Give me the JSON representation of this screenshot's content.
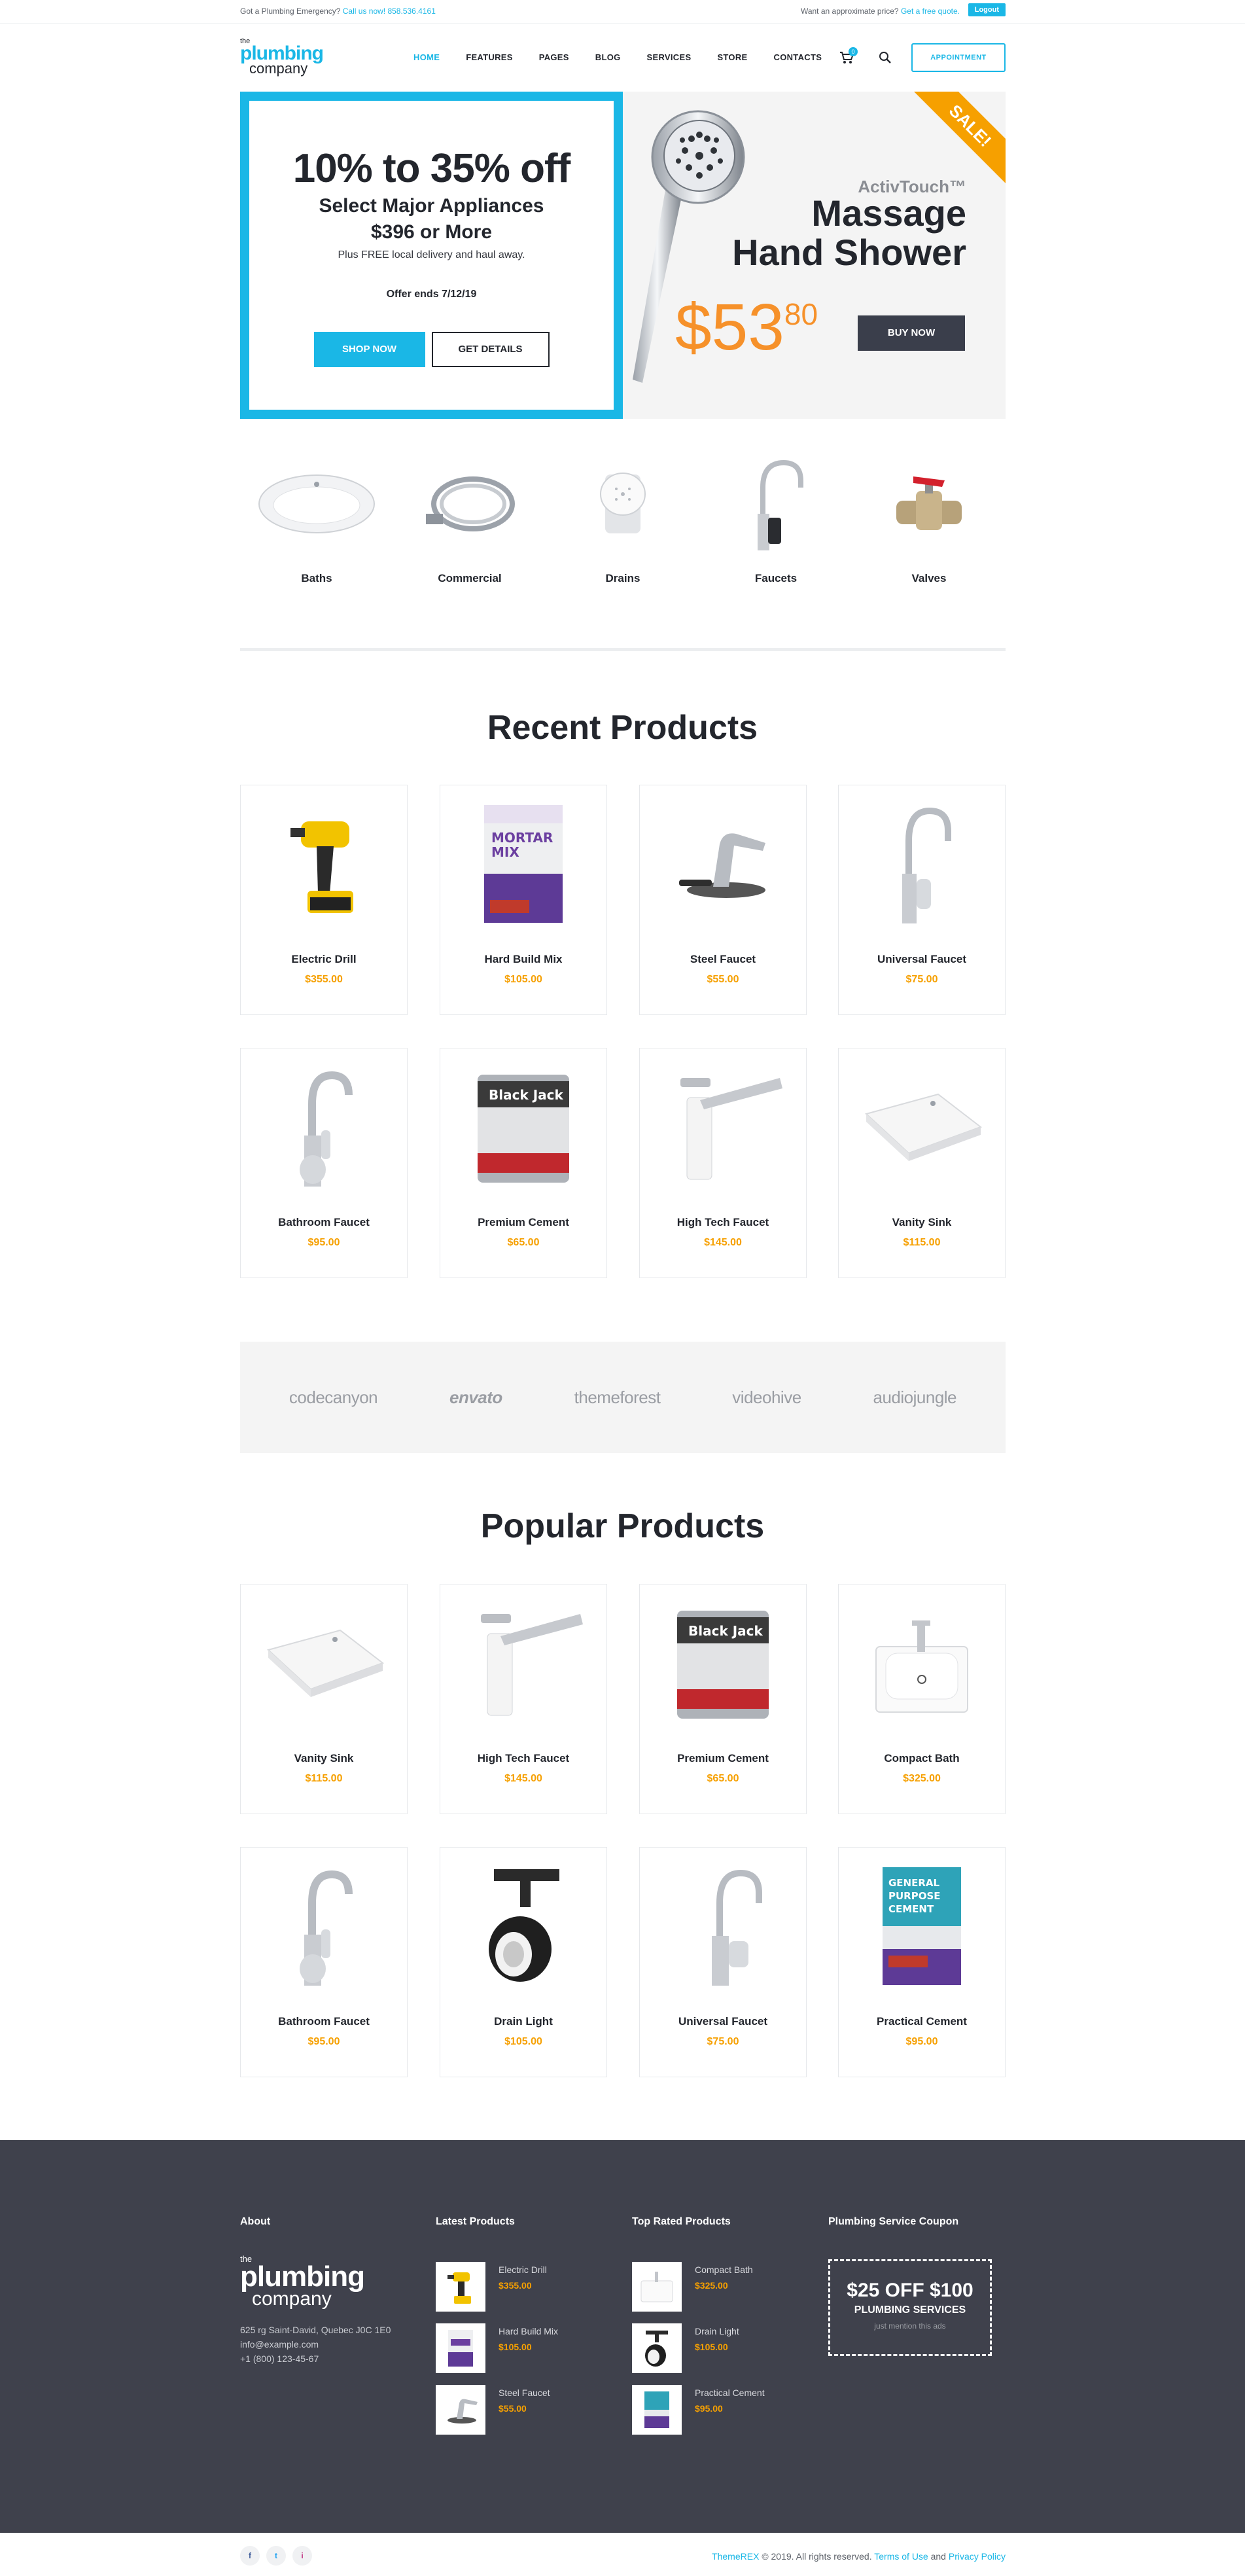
{
  "topbar": {
    "emergency_text": "Got a Plumbing Emergency?",
    "call_text": "Call us now! 858.536.4161",
    "quote_text": "Want an approximate price?",
    "quote_link": "Get a free quote.",
    "logout": "Logout"
  },
  "header": {
    "logo_the": "the",
    "logo_plumbing": "plumbing",
    "logo_company": "company",
    "nav": [
      "HOME",
      "FEATURES",
      "PAGES",
      "BLOG",
      "SERVICES",
      "STORE",
      "CONTACTS"
    ],
    "cart_count": "0",
    "appointment": "APPOINTMENT"
  },
  "hero": {
    "headline": "10% to 35% off",
    "sub1": "Select Major Appliances",
    "sub2": "$396 or More",
    "delivery": "Plus FREE local delivery and haul away.",
    "offer_ends": "Offer ends 7/12/19",
    "shop_now": "SHOP NOW",
    "get_details": "GET DETAILS",
    "sale": "SALE!",
    "brand": "ActivTouch™",
    "product_line1": "Massage",
    "product_line2": "Hand Shower",
    "price_main": "$53",
    "price_cents": "80",
    "buy_now": "BUY NOW"
  },
  "categories": [
    "Baths",
    "Commercial",
    "Drains",
    "Faucets",
    "Valves"
  ],
  "recent": {
    "title": "Recent Products",
    "items": [
      {
        "name": "Electric Drill",
        "price": "$355.00"
      },
      {
        "name": "Hard Build Mix",
        "price": "$105.00"
      },
      {
        "name": "Steel Faucet",
        "price": "$55.00"
      },
      {
        "name": "Universal Faucet",
        "price": "$75.00"
      },
      {
        "name": "Bathroom Faucet",
        "price": "$95.00"
      },
      {
        "name": "Premium Cement",
        "price": "$65.00"
      },
      {
        "name": "High Tech Faucet",
        "price": "$145.00"
      },
      {
        "name": "Vanity Sink",
        "price": "$115.00"
      }
    ]
  },
  "brands": [
    "codecanyon",
    "envato",
    "themeforest",
    "videohive",
    "audiojungle"
  ],
  "popular": {
    "title": "Popular Products",
    "items": [
      {
        "name": "Vanity Sink",
        "price": "$115.00"
      },
      {
        "name": "High Tech Faucet",
        "price": "$145.00"
      },
      {
        "name": "Premium Cement",
        "price": "$65.00"
      },
      {
        "name": "Compact Bath",
        "price": "$325.00"
      },
      {
        "name": "Bathroom Faucet",
        "price": "$95.00"
      },
      {
        "name": "Drain Light",
        "price": "$105.00"
      },
      {
        "name": "Universal Faucet",
        "price": "$75.00"
      },
      {
        "name": "Practical Cement",
        "price": "$95.00"
      }
    ]
  },
  "footer": {
    "about_title": "About",
    "address": "625 rg Saint-David, Quebec J0C 1E0",
    "email": "info@example.com",
    "phone": "+1 (800) 123-45-67",
    "latest_title": "Latest Products",
    "latest": [
      {
        "name": "Electric Drill",
        "price": "$355.00"
      },
      {
        "name": "Hard Build Mix",
        "price": "$105.00"
      },
      {
        "name": "Steel Faucet",
        "price": "$55.00"
      }
    ],
    "top_title": "Top Rated Products",
    "top": [
      {
        "name": "Compact Bath",
        "price": "$325.00"
      },
      {
        "name": "Drain Light",
        "price": "$105.00"
      },
      {
        "name": "Practical Cement",
        "price": "$95.00"
      }
    ],
    "coupon_title": "Plumbing Service Coupon",
    "coupon_big": "$25 OFF $100",
    "coupon_small": "PLUMBING SERVICES",
    "coupon_tiny": "just mention this ads"
  },
  "bottom": {
    "social": [
      "f",
      "t",
      "i"
    ],
    "brand": "ThemeREX",
    "copyright": "© 2019. All rights reserved.",
    "terms": "Terms of Use",
    "and": "and",
    "privacy": "Privacy Policy"
  }
}
